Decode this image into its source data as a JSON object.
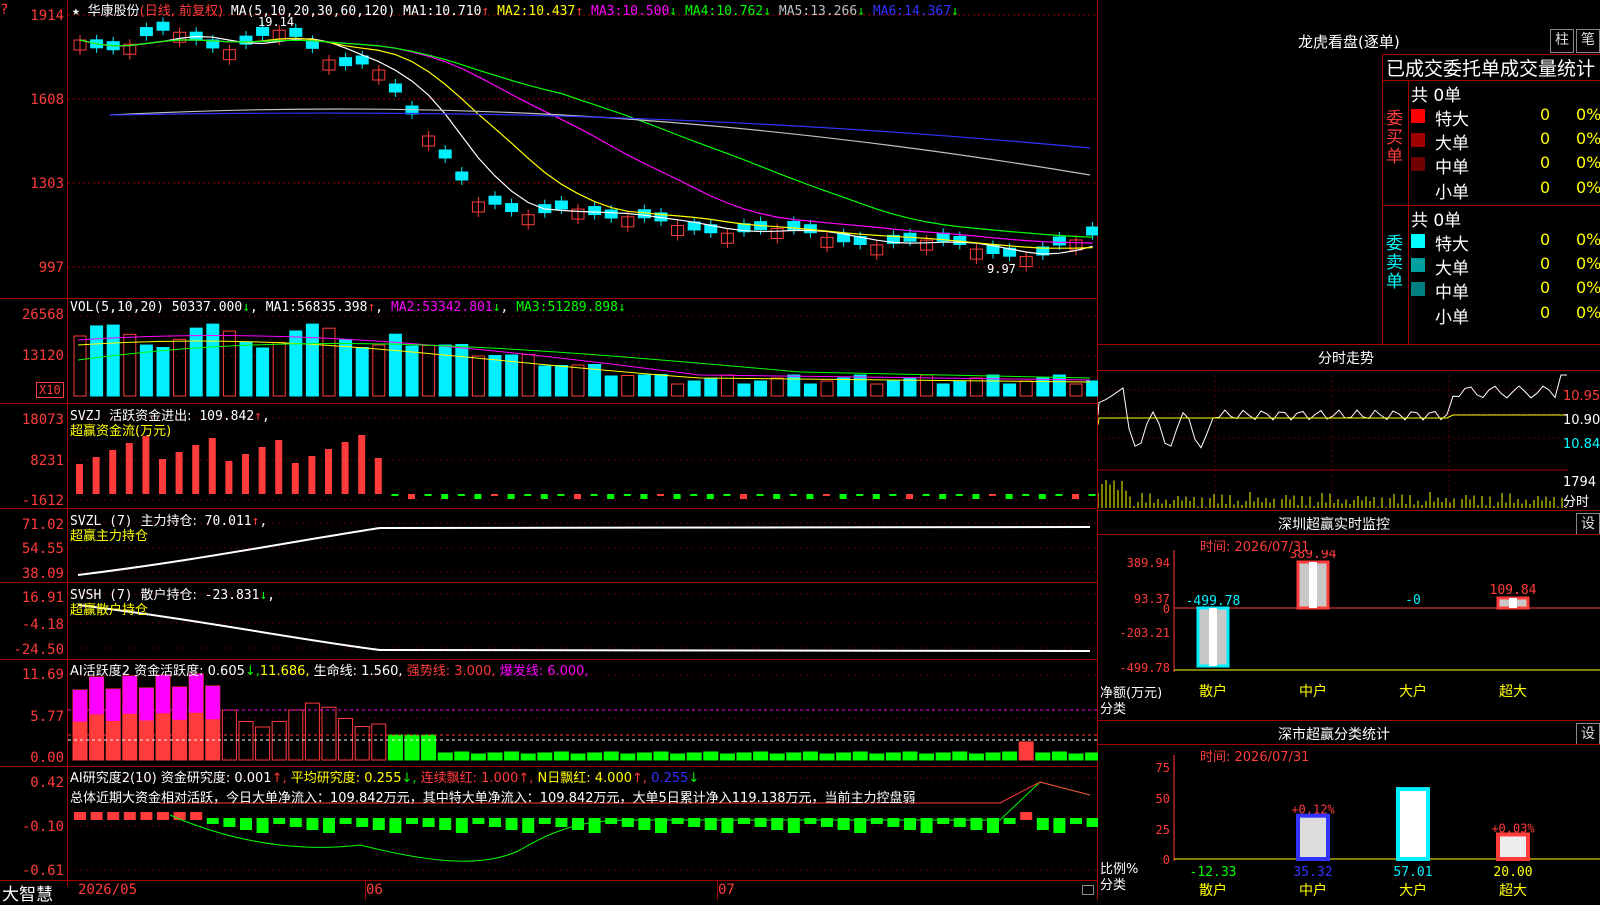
{
  "colors": {
    "up": "#ff3b3b",
    "down": "#00f0ff",
    "grid": "#a00000",
    "yellow": "#ffff00",
    "magenta": "#ff00ff",
    "green": "#00ff00",
    "blue": "#3333ff",
    "white": "#ffffff",
    "gray": "#c0c0c0"
  },
  "price_panel": {
    "star": "★",
    "stock_name": "华康股份",
    "mode": "(日线, 前复权)",
    "ma_params": "MA(5,10,20,30,60,120)",
    "ma_values": [
      {
        "label": "MA1:",
        "value": "10.710",
        "arrow": "↑"
      },
      {
        "label": "MA2:",
        "value": "10.437",
        "arrow": "↑"
      },
      {
        "label": "MA3:",
        "value": "10.500",
        "arrow": "↓"
      },
      {
        "label": "MA4:",
        "value": "10.762",
        "arrow": "↓"
      },
      {
        "label": "MA5:",
        "value": "13.266",
        "arrow": "↓"
      },
      {
        "label": "MA6:",
        "value": "14.367",
        "arrow": "↓"
      }
    ],
    "y_ticks": [
      "1914",
      "1608",
      "1303",
      "997"
    ],
    "high_label": "19.14",
    "low_label": "9.97",
    "question": "?"
  },
  "vol_panel": {
    "title": "VOL(5,10,20)",
    "value": "50337.000",
    "arrow": "↓",
    "ma": [
      {
        "label": "MA1:",
        "value": "56835.398",
        "arrow": "↑"
      },
      {
        "label": "MA2:",
        "value": "53342.801",
        "arrow": "↓"
      },
      {
        "label": "MA3:",
        "value": "51289.898",
        "arrow": "↓"
      }
    ],
    "y_ticks": [
      "26568",
      "13120"
    ],
    "unit": "X10"
  },
  "svzj_panel": {
    "title": "SVZJ",
    "label": "活跃资金进出:",
    "value": "109.842",
    "arrow": "↑",
    "subtitle": "超赢资金流(万元)",
    "y_ticks": [
      "18073",
      "8231",
      "-1612"
    ]
  },
  "svzl_panel": {
    "title": "SVZL (7)",
    "label": "主力持仓:",
    "value": "70.011",
    "arrow": "↑",
    "subtitle": "超赢主力持仓",
    "y_ticks": [
      "71.02",
      "54.55",
      "38.09"
    ]
  },
  "svsh_panel": {
    "title": "SVSH (7)",
    "label": "散户持仓:",
    "value": "-23.831",
    "arrow": "↓",
    "subtitle": "超赢散户持仓",
    "y_ticks": [
      "16.91",
      "-4.18",
      "-24.50"
    ]
  },
  "ai1_panel": {
    "title": "AI活跃度2",
    "parts": [
      {
        "text": "资金活跃度: 0.605",
        "c": "w"
      },
      {
        "text": "↓,",
        "c": "g"
      },
      {
        "text": "11.686,",
        "c": "y"
      },
      {
        "text": "生命线: 1.560,",
        "c": "w"
      },
      {
        "text": "强势线: 3.000,",
        "c": "r"
      },
      {
        "text": "爆发线: 6.000,",
        "c": "m"
      }
    ],
    "y_ticks": [
      "11.69",
      "5.77",
      "0.00"
    ]
  },
  "ai2_panel": {
    "title": "AI研究度2(10)",
    "parts": [
      {
        "text": "资金研究度: 0.001",
        "c": "w"
      },
      {
        "text": "↑,",
        "c": "r"
      },
      {
        "text": "平均研究度: 0.255",
        "c": "y"
      },
      {
        "text": "↓,",
        "c": "g"
      },
      {
        "text": "连续飘红: 1.000",
        "c": "r"
      },
      {
        "text": "↑,",
        "c": "r"
      },
      {
        "text": "N日飘红: 4.000",
        "c": "y"
      },
      {
        "text": "↑,",
        "c": "r"
      },
      {
        "text": "0.255",
        "c": "b"
      },
      {
        "text": "↓",
        "c": "g"
      }
    ],
    "summary": "总体近期大资金相对活跃，今日大单净流入：109.842万元，其中特大单净流入：109.842万元，大单5日累计净入119.138万元，当前主力控盘弱",
    "y_ticks": [
      "0.42",
      "-0.10",
      "-0.61"
    ]
  },
  "bottom_bar": {
    "logo": "大智慧",
    "dates": [
      "2026/05",
      "06",
      "07"
    ]
  },
  "right_panel": {
    "title": "龙虎看盘(逐单)",
    "btn1": "柱",
    "btn2": "笔",
    "tabs": "已成交委托单成交量统计",
    "buy": {
      "side": "委买单",
      "total": "共 0单",
      "rows": [
        {
          "name": "特大",
          "n": "0",
          "p": "0%",
          "color": "#ff0000"
        },
        {
          "name": "大单",
          "n": "0",
          "p": "0%",
          "color": "#a00000"
        },
        {
          "name": "中单",
          "n": "0",
          "p": "0%",
          "color": "#700000"
        },
        {
          "name": "小单",
          "n": "0",
          "p": "0%",
          "color": ""
        }
      ]
    },
    "sell": {
      "side": "委卖单",
      "total": "共 0单",
      "rows": [
        {
          "name": "特大",
          "n": "0",
          "p": "0%",
          "color": "#00ffff"
        },
        {
          "name": "大单",
          "n": "0",
          "p": "0%",
          "color": "#00a0a0"
        },
        {
          "name": "中单",
          "n": "0",
          "p": "0%",
          "color": "#008080"
        },
        {
          "name": "小单",
          "n": "0",
          "p": "0%",
          "color": ""
        }
      ]
    },
    "intraday": {
      "title": "分时走势",
      "prices": [
        "10.95",
        "10.90",
        "10.84"
      ],
      "vol": "1794",
      "vol_label": "分时"
    },
    "monitor": {
      "title": "深圳超赢实时监控",
      "btn": "设",
      "time": "时间: 2026/07/31",
      "y_ticks": [
        "389.94",
        "93.37",
        "0",
        "-203.21",
        "-499.78"
      ],
      "y_label": "净额(万元)",
      "x_label": "分类",
      "categories": [
        "散户",
        "中户",
        "大户",
        "超大"
      ],
      "values": [
        "-499.78",
        "389.94",
        "-0",
        "109.84"
      ]
    },
    "stats": {
      "title": "深市超赢分类统计",
      "btn": "设",
      "time": "时间: 2026/07/31",
      "y_ticks": [
        "75",
        "50",
        "25",
        "0"
      ],
      "y_label": "比例%",
      "x_label": "分类",
      "categories": [
        "散户",
        "中户",
        "大户",
        "超大"
      ],
      "values": [
        "-12.33",
        "35.32",
        "57.01",
        "20.00"
      ],
      "changes": [
        "",
        "+0.12%",
        "",
        "+0.03%"
      ]
    }
  }
}
